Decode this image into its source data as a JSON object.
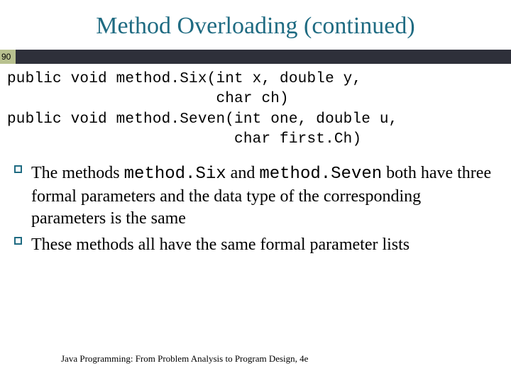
{
  "slide": {
    "title": "Method Overloading (continued)",
    "number": "90"
  },
  "code": {
    "line1": "public void method.Six(int x, double y,",
    "line2": "                       char ch)",
    "line3": "public void method.Seven(int one, double u,",
    "line4": "                         char first.Ch)"
  },
  "bullets": {
    "b1": {
      "pre": "The methods ",
      "code1": "method.Six",
      "mid": " and ",
      "code2": "method.Seven",
      "post": " both have three formal parameters and the data type of the corresponding parameters is the same"
    },
    "b2": {
      "text": "These methods all have the same formal parameter lists"
    }
  },
  "footer": {
    "text": "Java Programming: From Problem Analysis to Program Design, 4e"
  }
}
